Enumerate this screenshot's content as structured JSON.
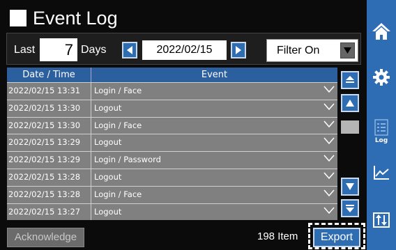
{
  "header": {
    "title": "Event Log"
  },
  "filter": {
    "last_label": "Last",
    "days_value": "7",
    "days_label": "Days",
    "date": "2022/02/15",
    "filter_value": "Filter On"
  },
  "table": {
    "columns": [
      "Date / Time",
      "Event"
    ],
    "rows": [
      {
        "datetime": "2022/02/15 13:31",
        "event": "Login / Face"
      },
      {
        "datetime": "2022/02/15 13:30",
        "event": "Logout"
      },
      {
        "datetime": "2022/02/15 13:30",
        "event": "Login / Face"
      },
      {
        "datetime": "2022/02/15 13:29",
        "event": "Logout"
      },
      {
        "datetime": "2022/02/15 13:29",
        "event": "Login / Password"
      },
      {
        "datetime": "2022/02/15 13:28",
        "event": "Logout"
      },
      {
        "datetime": "2022/02/15 13:28",
        "event": "Login / Face"
      },
      {
        "datetime": "2022/02/15 13:27",
        "event": "Logout"
      }
    ]
  },
  "footer": {
    "acknowledge_label": "Acknowledge",
    "item_count": "198 Item",
    "export_label": "Export"
  },
  "sidebar": {
    "items": [
      {
        "icon": "home-icon",
        "label": ""
      },
      {
        "icon": "gear-icon",
        "label": ""
      },
      {
        "icon": "log-icon",
        "label": "Log",
        "active": true
      },
      {
        "icon": "chart-icon",
        "label": ""
      },
      {
        "icon": "sort-icon",
        "label": ""
      }
    ]
  },
  "colors": {
    "accent": "#2e6cb4",
    "header_row": "#2c5f9e",
    "row_bg": "#808080",
    "background": "#0b0b0b"
  }
}
